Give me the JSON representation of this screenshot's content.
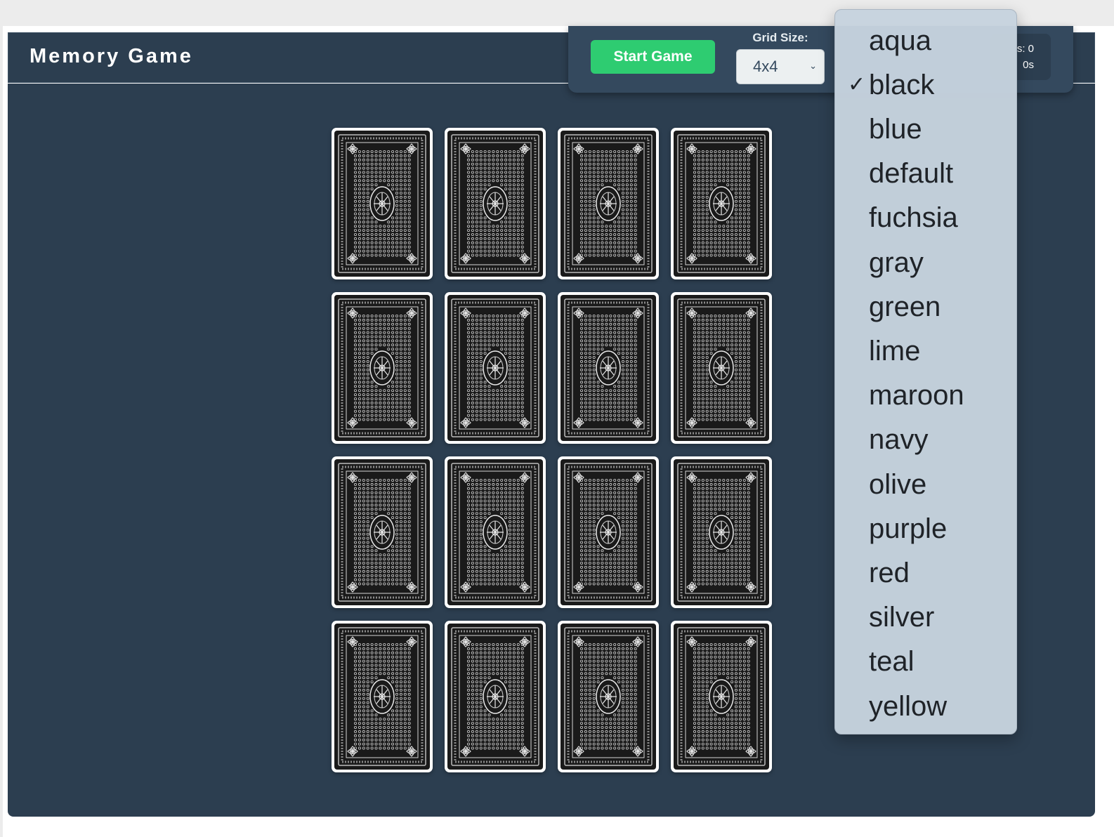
{
  "header": {
    "title": "Memory Game"
  },
  "controls": {
    "start_label": "Start Game",
    "grid_size_label": "Grid Size:",
    "grid_size_value": "4x4",
    "stats": {
      "moves_text": "s: 0",
      "time_text": "0s"
    }
  },
  "board": {
    "rows": 4,
    "cols": 4,
    "face_down_cards": 16,
    "card_back": "black"
  },
  "theme_dropdown": {
    "selected": "black",
    "options": [
      "aqua",
      "black",
      "blue",
      "default",
      "fuchsia",
      "gray",
      "green",
      "lime",
      "maroon",
      "navy",
      "olive",
      "purple",
      "red",
      "silver",
      "teal",
      "yellow"
    ],
    "check_glyph": "✓"
  },
  "colors": {
    "header_bg": "#2c3e50",
    "start_button": "#2ecc71",
    "card_back": "#1a1a1a"
  },
  "icons": {
    "select_chevron": "chevron-down-icon",
    "selected_option": "checkmark-icon"
  }
}
